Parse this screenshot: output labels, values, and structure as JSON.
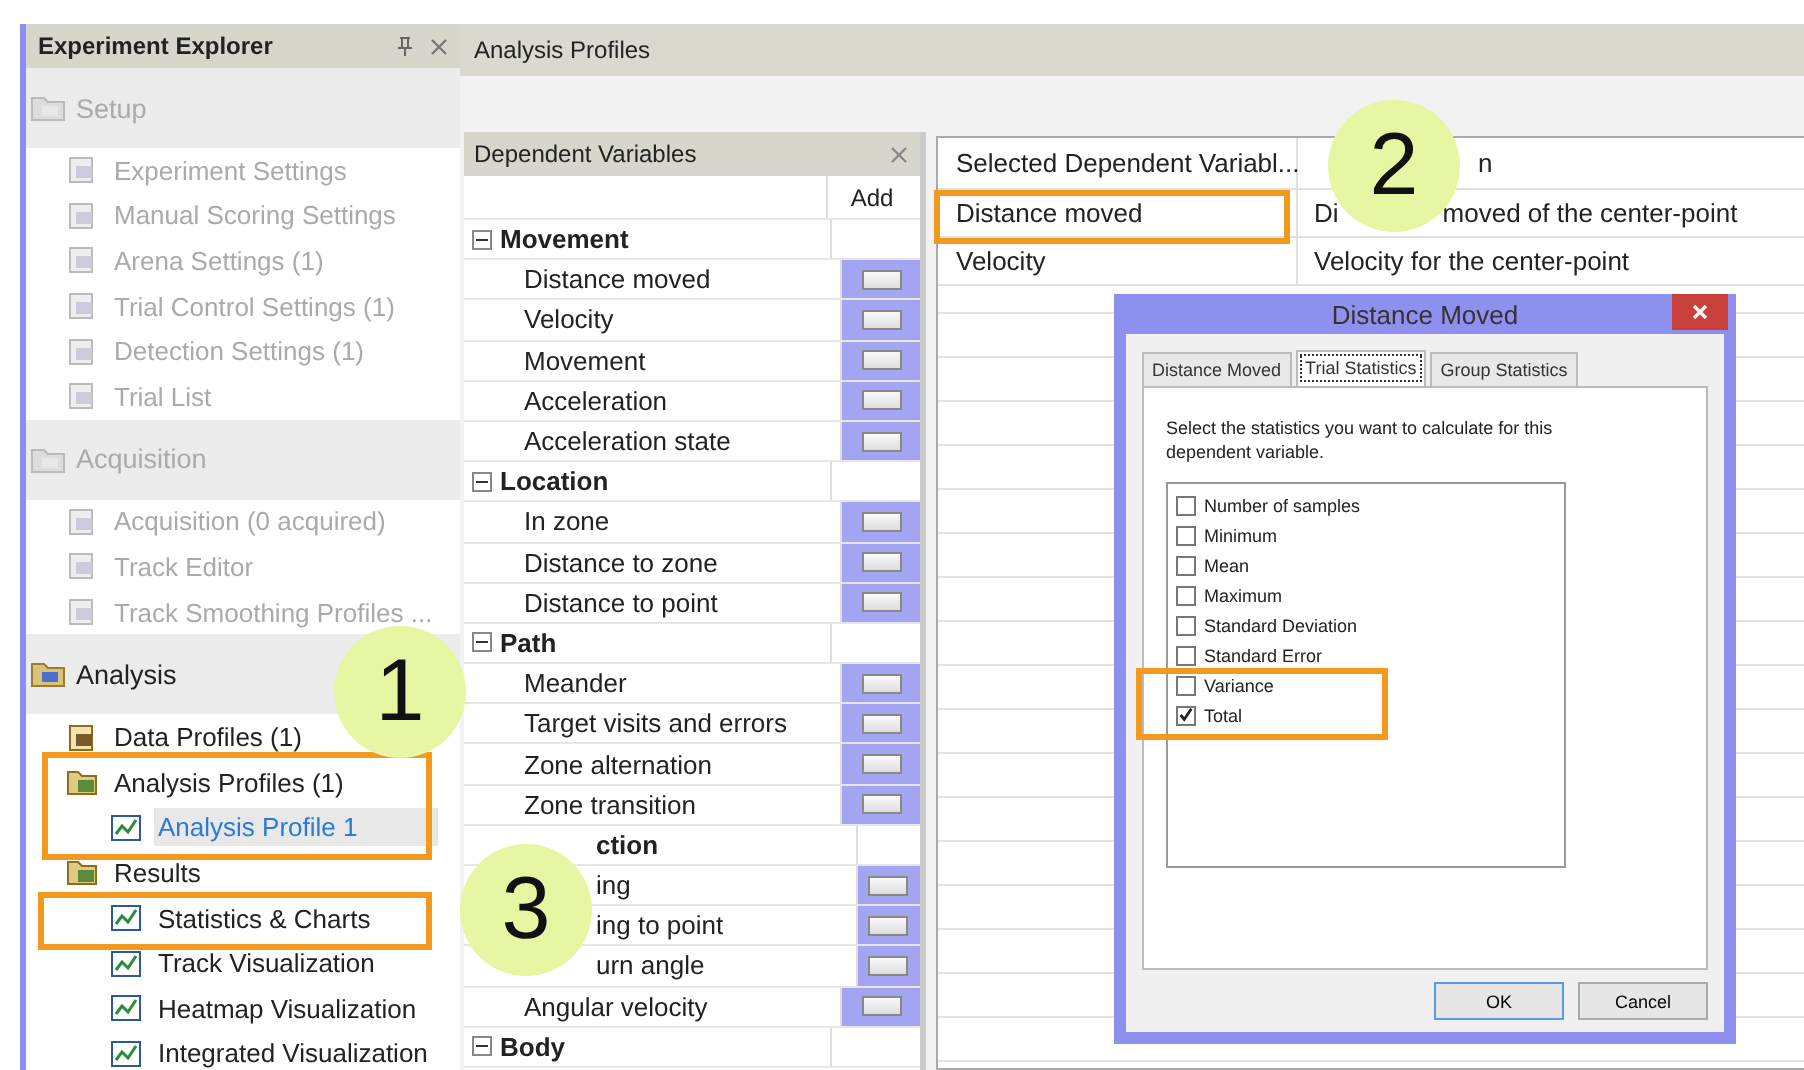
{
  "explorer": {
    "title": "Experiment Explorer",
    "sections": [
      {
        "label": "Setup",
        "disabled": true,
        "items": [
          {
            "label": "Experiment Settings",
            "disabled": true,
            "selected": false
          },
          {
            "label": "Manual Scoring Settings",
            "disabled": true,
            "selected": false
          },
          {
            "label": "Arena Settings (1)",
            "disabled": true,
            "selected": false
          },
          {
            "label": "Trial Control Settings (1)",
            "disabled": true,
            "selected": false
          },
          {
            "label": "Detection Settings (1)",
            "disabled": true,
            "selected": false
          },
          {
            "label": "Trial List",
            "disabled": true,
            "selected": false
          }
        ]
      },
      {
        "label": "Acquisition",
        "disabled": true,
        "items": [
          {
            "label": "Acquisition (0 acquired)",
            "disabled": true,
            "selected": false
          },
          {
            "label": "Track Editor",
            "disabled": true,
            "selected": false
          },
          {
            "label": "Track Smoothing Profiles ...",
            "disabled": true,
            "selected": false
          }
        ]
      },
      {
        "label": "Analysis",
        "disabled": false,
        "items": [
          {
            "label": "Data Profiles (1)",
            "disabled": false,
            "selected": false
          },
          {
            "label": "Analysis Profiles (1)",
            "disabled": false,
            "selected": false,
            "children": [
              {
                "label": "Analysis Profile 1",
                "disabled": false,
                "selected": true
              }
            ]
          },
          {
            "label": "Results",
            "disabled": false,
            "selected": false,
            "children": [
              {
                "label": "Statistics & Charts",
                "disabled": false,
                "selected": false
              },
              {
                "label": "Track Visualization",
                "disabled": false,
                "selected": false
              },
              {
                "label": "Heatmap Visualization",
                "disabled": false,
                "selected": false
              },
              {
                "label": "Integrated Visualization",
                "disabled": false,
                "selected": false
              }
            ]
          }
        ]
      }
    ]
  },
  "main": {
    "title": "Analysis Profiles"
  },
  "dependent_variables": {
    "title": "Dependent Variables",
    "add_column": "Add",
    "groups": [
      {
        "label": "Movement",
        "expanded": true,
        "covered": false,
        "items": [
          {
            "label": "Distance moved",
            "covered": false
          },
          {
            "label": "Velocity",
            "covered": false
          },
          {
            "label": "Movement",
            "covered": false
          },
          {
            "label": "Acceleration",
            "covered": false
          },
          {
            "label": "Acceleration state",
            "covered": false
          }
        ]
      },
      {
        "label": "Location",
        "expanded": true,
        "covered": false,
        "items": [
          {
            "label": "In zone",
            "covered": false
          },
          {
            "label": "Distance to zone",
            "covered": false
          },
          {
            "label": "Distance to point",
            "covered": false
          }
        ]
      },
      {
        "label": "Path",
        "expanded": true,
        "covered": false,
        "items": [
          {
            "label": "Meander",
            "covered": false
          },
          {
            "label": "Target visits and errors",
            "covered": false
          },
          {
            "label": "Zone alternation",
            "covered": false
          },
          {
            "label": "Zone transition",
            "covered": false
          }
        ]
      },
      {
        "label": "ction",
        "expanded": true,
        "covered": true,
        "items": [
          {
            "label": "ing",
            "covered": true
          },
          {
            "label": "ing to point",
            "covered": true
          },
          {
            "label": "urn angle",
            "covered": true
          },
          {
            "label": "Angular velocity",
            "covered": false
          }
        ]
      },
      {
        "label": "Body",
        "expanded": true,
        "covered": false
      }
    ]
  },
  "selected_table": {
    "columns": [
      {
        "label": "Selected Dependent Variabl...",
        "covered": false
      },
      {
        "label": "n",
        "covered": true
      }
    ],
    "rows": [
      {
        "column_1": "Distance moved",
        "column_2_parts": [
          "Di",
          "moved of the center-point"
        ]
      },
      {
        "column_1": "Velocity",
        "column_2_parts": [
          "Velocity for the center-point"
        ]
      }
    ]
  },
  "dialog": {
    "title": "Distance Moved",
    "tabs": [
      {
        "label": "Distance Moved",
        "selected": false
      },
      {
        "label": "Trial Statistics",
        "selected": true
      },
      {
        "label": "Group Statistics",
        "selected": false
      }
    ],
    "instruction": "Select the statistics you want to calculate for this dependent variable.",
    "options": [
      {
        "label": "Number of samples",
        "checked": false
      },
      {
        "label": "Minimum",
        "checked": false
      },
      {
        "label": "Mean",
        "checked": false
      },
      {
        "label": "Maximum",
        "checked": false
      },
      {
        "label": "Standard Deviation",
        "checked": false
      },
      {
        "label": "Standard Error",
        "checked": false
      },
      {
        "label": "Variance",
        "checked": false
      },
      {
        "label": "Total",
        "checked": true
      }
    ],
    "buttons": [
      "OK",
      "Cancel"
    ]
  },
  "callouts": [
    {
      "label": "1"
    },
    {
      "label": "2"
    },
    {
      "label": "3"
    }
  ]
}
